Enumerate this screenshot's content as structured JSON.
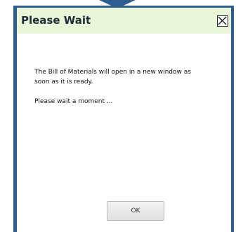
{
  "dialog": {
    "title": "Please Wait",
    "close_icon": "close-box-icon",
    "message_line1": "The Bill of Materials will open in a new window as soon as it is ready.",
    "message_line2": "Please wait a moment ...",
    "ok_label": "OK"
  },
  "colors": {
    "frame_border": "#2e5d91",
    "title_background": "#e8f7d7",
    "button_background": "#e6e6e6"
  }
}
